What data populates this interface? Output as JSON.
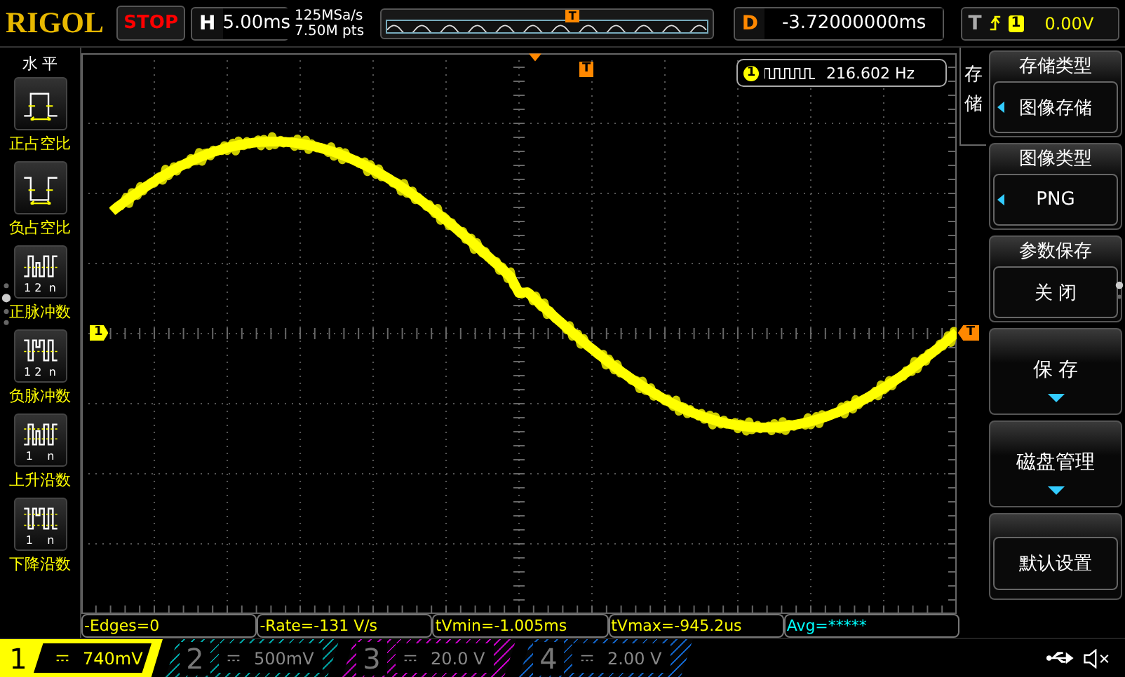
{
  "header": {
    "logo": "RIGOL",
    "run_state": "STOP",
    "horizontal": {
      "label": "H",
      "value": "5.00ms"
    },
    "sample_rate": "125MSa/s",
    "memory_depth": "7.50M pts",
    "overview_marker": "T",
    "delay": {
      "label": "D",
      "value": "-3.72000000ms"
    },
    "trigger": {
      "label": "T",
      "source": "1",
      "level": "0.00V"
    }
  },
  "left_menu": {
    "title": "水 平",
    "items": [
      {
        "label": "正占空比",
        "kind": "pos-duty"
      },
      {
        "label": "负占空比",
        "kind": "neg-duty"
      },
      {
        "label": "正脉冲数",
        "kind": "pos-pulses",
        "caption": "1 2  n"
      },
      {
        "label": "负脉冲数",
        "kind": "neg-pulses",
        "caption": "1 2  n"
      },
      {
        "label": "上升沿数",
        "kind": "rising-edges",
        "caption": "1    n"
      },
      {
        "label": "下降沿数",
        "kind": "falling-edges",
        "caption": "1    n"
      }
    ]
  },
  "plot": {
    "channel_marker": "1",
    "trigger_position_marker": "T",
    "trigger_level_marker": "T",
    "frequency": {
      "channel": "1",
      "value": "216.602 Hz"
    }
  },
  "right_menu": {
    "title": "存储",
    "items": [
      {
        "kind": "select",
        "title": "存储类型",
        "value": "图像存储",
        "arrow": true
      },
      {
        "kind": "select",
        "title": "图像类型",
        "value": "PNG",
        "arrow": true
      },
      {
        "kind": "select",
        "title": "参数保存",
        "value": "关 闭",
        "arrow": false
      },
      {
        "kind": "submenu",
        "label": "保 存"
      },
      {
        "kind": "submenu",
        "label": "磁盘管理"
      },
      {
        "kind": "action",
        "label": "默认设置"
      }
    ]
  },
  "measurements": [
    {
      "text": "-Edges=0",
      "color": "#ffff00"
    },
    {
      "text": "-Rate=-131 V/s",
      "color": "#ffff00"
    },
    {
      "text": "tVmin=-1.005ms",
      "color": "#ffff00"
    },
    {
      "text": "tVmax=-945.2us",
      "color": "#ffff00"
    },
    {
      "text": "Avg=*****",
      "color": "#00ffff"
    }
  ],
  "channels": [
    {
      "number": "1",
      "scale": "740mV",
      "selected": true,
      "color": "#ffff00"
    },
    {
      "number": "2",
      "scale": "500mV",
      "selected": false,
      "color": "#00a0a0"
    },
    {
      "number": "3",
      "scale": "20.0 V",
      "selected": false,
      "color": "#c000c0"
    },
    {
      "number": "4",
      "scale": "2.00 V",
      "selected": false,
      "color": "#1060c0"
    }
  ]
}
